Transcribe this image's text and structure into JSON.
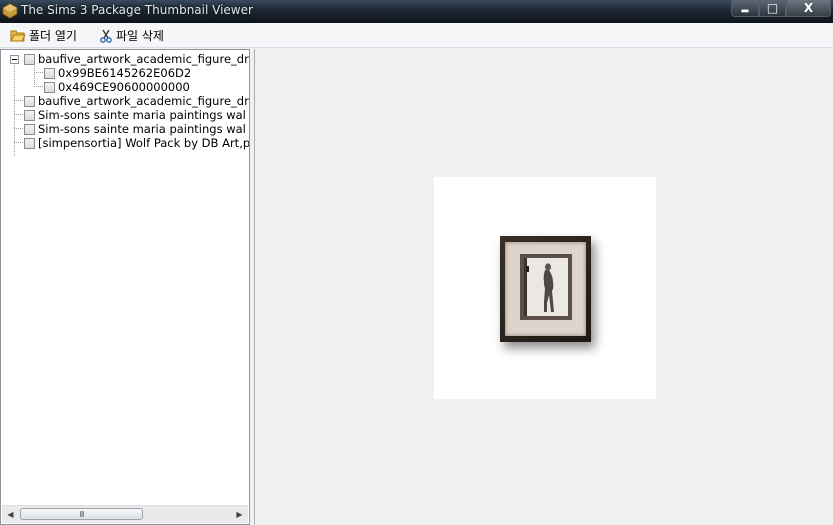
{
  "window": {
    "title": "The Sims 3 Package Thumbnail Viewer",
    "controls": {
      "minimize": "▂",
      "maximize": "□",
      "close": "X"
    }
  },
  "toolbar": {
    "open_folder_label": "폴더 열기",
    "delete_file_label": "파일 삭제"
  },
  "tree": {
    "items": [
      {
        "label": "baufive_artwork_academic_figure_dra",
        "expanded": true,
        "level": 0
      },
      {
        "label": "0x99BE6145262E06D2",
        "level": 1
      },
      {
        "label": "0x469CE90600000000",
        "level": 1
      },
      {
        "label": "baufive_artwork_academic_figure_dra",
        "level": 0
      },
      {
        "label": "Sim-sons sainte maria paintings wal",
        "level": 0
      },
      {
        "label": "Sim-sons sainte maria paintings wal",
        "level": 0
      },
      {
        "label": "[simpensortia] Wolf Pack by DB Art,p",
        "level": 0
      }
    ]
  },
  "scrollbar": {
    "left_arrow": "◀",
    "right_arrow": "▶",
    "grip": "III"
  },
  "colors": {
    "titlebar": "#1d2733",
    "pane_bg": "#f0f0f0",
    "frame": "#2b231c"
  }
}
